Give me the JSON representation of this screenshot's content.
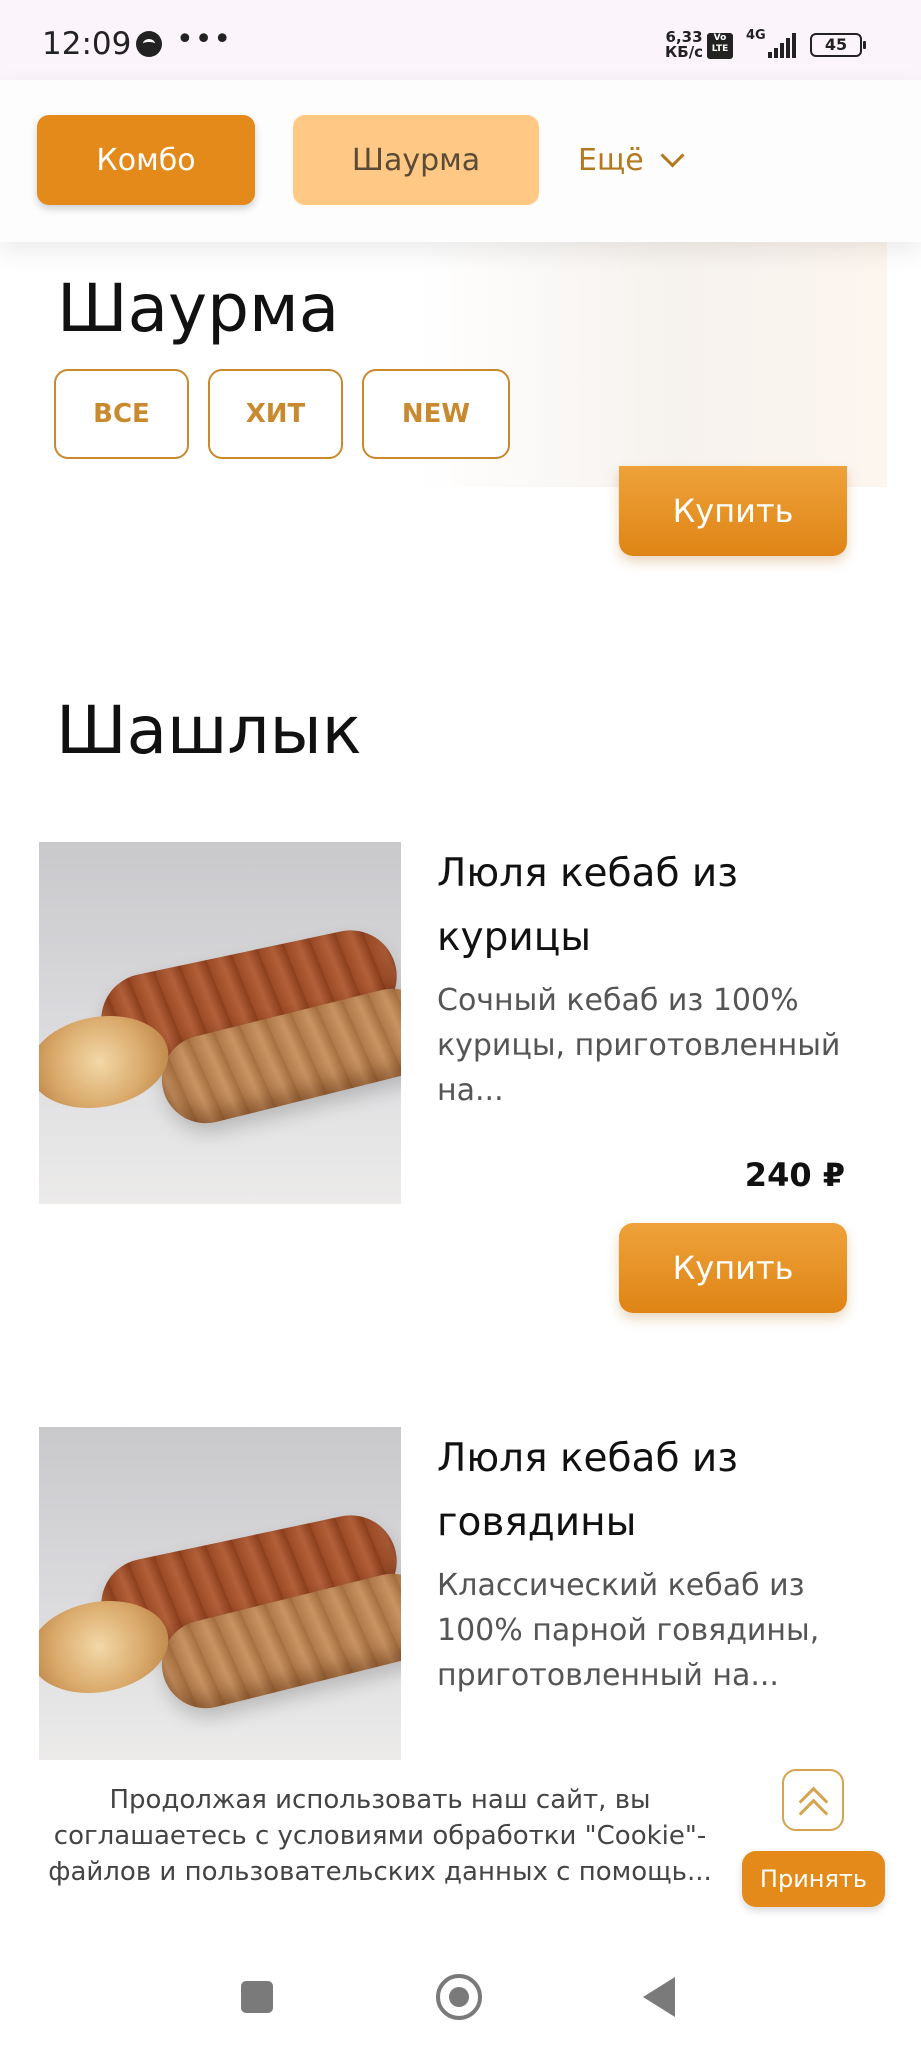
{
  "status_bar": {
    "time": "12:09",
    "dots": "•••",
    "speed_value": "6,33",
    "speed_unit": "КБ/с",
    "volte": "Vo LTE",
    "network": "4G",
    "battery": "45"
  },
  "category_nav": {
    "items": [
      {
        "label": "Комбо",
        "state": "active"
      },
      {
        "label": "Шаурма",
        "state": "selected"
      },
      {
        "label": "Ещё",
        "state": "dropdown"
      }
    ]
  },
  "shawarma_section": {
    "title": "Шаурма",
    "filters": [
      "ВСЕ",
      "ХИТ",
      "NEW"
    ],
    "buy_label": "Купить"
  },
  "shashlik_section": {
    "title": "Шашлык",
    "products": [
      {
        "name": "Люля кебаб из курицы",
        "description": "Сочный кебаб из 100% курицы, приготовленный на...",
        "price": "240 ₽",
        "buy_label": "Купить"
      },
      {
        "name": "Люля кебаб из говядины",
        "description": "Классический кебаб из 100% парной говядины, приготовленный на..."
      }
    ]
  },
  "cookie_banner": {
    "text": "Продолжая использовать наш сайт, вы соглашаетесь с условиями обработки \"Cookie\"-файлов и пользовательских данных с помощь...",
    "accept_label": "Принять"
  },
  "colors": {
    "accent": "#e38a1a",
    "accent_light": "#ffc985",
    "outline": "#c9892e"
  }
}
